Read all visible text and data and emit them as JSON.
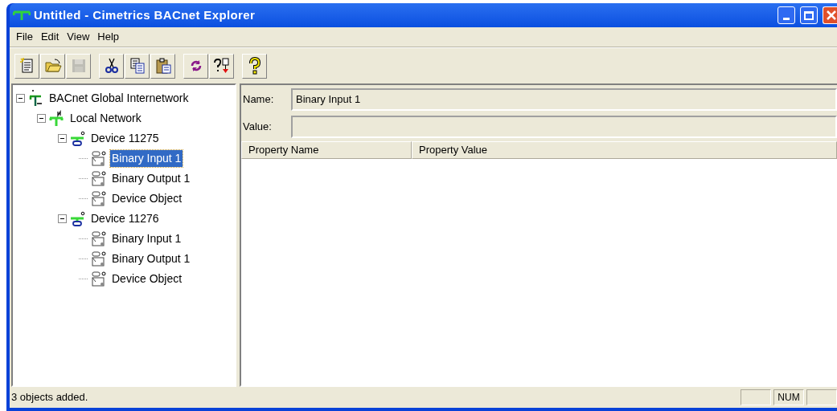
{
  "window": {
    "title": "Untitled - Cimetrics BACnet Explorer"
  },
  "menu": [
    "File",
    "Edit",
    "View",
    "Help"
  ],
  "toolbar": [
    {
      "kind": "new",
      "disabled": false
    },
    {
      "kind": "open",
      "disabled": false
    },
    {
      "kind": "save",
      "disabled": true
    },
    {
      "kind": "sep"
    },
    {
      "kind": "cut",
      "disabled": false
    },
    {
      "kind": "copy",
      "disabled": false
    },
    {
      "kind": "paste",
      "disabled": false
    },
    {
      "kind": "sep"
    },
    {
      "kind": "refresh",
      "disabled": false
    },
    {
      "kind": "whois",
      "disabled": false
    },
    {
      "kind": "sep"
    },
    {
      "kind": "help",
      "disabled": false
    }
  ],
  "tree": [
    {
      "label": "BACnet Global Internetwork",
      "kind": "internetwork",
      "expanded": true,
      "selected": false,
      "children": [
        {
          "label": "Local Network",
          "kind": "network",
          "expanded": true,
          "selected": false,
          "children": [
            {
              "label": "Device 11275",
              "kind": "device",
              "expanded": true,
              "selected": false,
              "children": [
                {
                  "label": "Binary Input 1",
                  "kind": "object",
                  "selected": true
                },
                {
                  "label": "Binary Output 1",
                  "kind": "object",
                  "selected": false
                },
                {
                  "label": "Device Object",
                  "kind": "object",
                  "selected": false
                }
              ]
            },
            {
              "label": "Device 11276",
              "kind": "device",
              "expanded": true,
              "selected": false,
              "children": [
                {
                  "label": "Binary Input 1",
                  "kind": "object",
                  "selected": false
                },
                {
                  "label": "Binary Output 1",
                  "kind": "object",
                  "selected": false
                },
                {
                  "label": "Device Object",
                  "kind": "object",
                  "selected": false
                }
              ]
            }
          ]
        }
      ]
    }
  ],
  "details": {
    "name_label": "Name:",
    "name_value": "Binary Input 1",
    "value_label": "Value:"
  },
  "table": {
    "columns": [
      "Property Name",
      "Property Value"
    ]
  },
  "status_bar": {
    "message": "3 objects added.",
    "indicator": "NUM"
  }
}
